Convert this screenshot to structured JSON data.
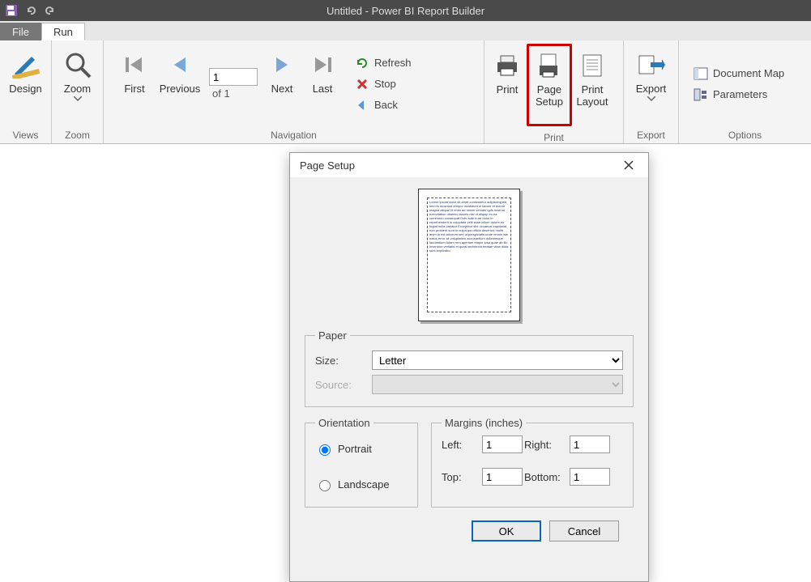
{
  "titlebar": {
    "title": "Untitled - Power BI Report Builder"
  },
  "tabs": {
    "file": "File",
    "run": "Run"
  },
  "ribbon": {
    "views": {
      "label": "Views",
      "design": "Design"
    },
    "zoom": {
      "label": "Zoom",
      "zoom": "Zoom"
    },
    "navigation": {
      "label": "Navigation",
      "first": "First",
      "previous": "Previous",
      "next": "Next",
      "last": "Last",
      "page_value": "1",
      "page_of": "of  1",
      "refresh": "Refresh",
      "stop": "Stop",
      "back": "Back"
    },
    "print": {
      "label": "Print",
      "print": "Print",
      "page_setup": "Page\nSetup",
      "print_layout": "Print\nLayout"
    },
    "export": {
      "label": "Export",
      "export": "Export"
    },
    "options": {
      "label": "Options",
      "document_map": "Document Map",
      "parameters": "Parameters"
    }
  },
  "dialog": {
    "title": "Page Setup",
    "paper": {
      "legend": "Paper",
      "size_label": "Size:",
      "size_value": "Letter",
      "source_label": "Source:"
    },
    "orientation": {
      "legend": "Orientation",
      "portrait": "Portrait",
      "landscape": "Landscape",
      "selected": "portrait"
    },
    "margins": {
      "legend": "Margins (inches)",
      "left_label": "Left:",
      "left_value": "1",
      "right_label": "Right:",
      "right_value": "1",
      "top_label": "Top:",
      "top_value": "1",
      "bottom_label": "Bottom:",
      "bottom_value": "1"
    },
    "ok": "OK",
    "cancel": "Cancel"
  }
}
